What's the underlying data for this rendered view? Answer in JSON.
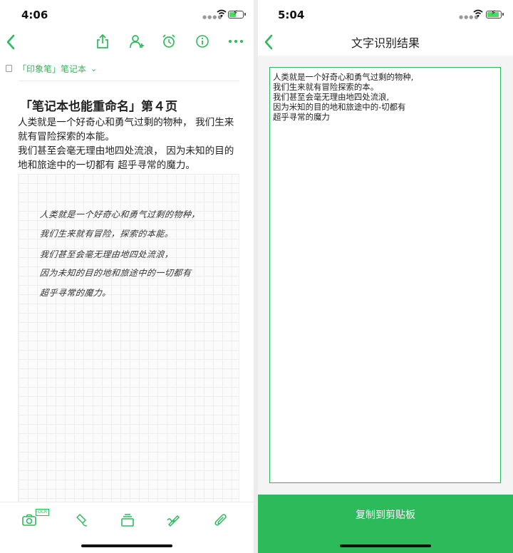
{
  "left": {
    "status": {
      "time": "4:06"
    },
    "notebook": {
      "label": "「印象笔」笔记本"
    },
    "note": {
      "title": "「笔记本也能重命名」第４页",
      "body": [
        "人类就是一个好奇心和勇气过剩的物种， 我们生来",
        "就有冒险探索的本能。",
        "我们甚至会毫无理由地四处流浪， 因为未知的目的",
        "地和旅途中的一切都有 超乎寻常的魔力。"
      ],
      "handwriting": [
        "人类就是一个好奇心和勇气过剩的物种，",
        "我们生来就有冒险，探索的本能。",
        "我们甚至会毫无理由地四处流浪，",
        "因为未知的目的地和旅途中的一切都有",
        "超乎寻常的魔力。"
      ]
    },
    "toolbar": {
      "ocr_badge": "OCR"
    }
  },
  "right": {
    "status": {
      "time": "5:04"
    },
    "title": "文字识别结果",
    "result_lines": [
      "人类就是一个好奇心和勇气过剩的物种,",
      "我们生来就有冒险探索的本。",
      "我们甚至会毫无理由地四处流浪,",
      "因为米知的目的地和旅途中的-切都有",
      "超乎寻常的魔力"
    ],
    "copy_button": "复制到剪贴板"
  },
  "icons": {
    "back": "chevron-left-icon",
    "share": "share-icon",
    "add_user": "add-user-icon",
    "alarm": "alarm-icon",
    "info": "info-icon",
    "more": "more-icon",
    "camera_ocr": "camera-ocr-icon",
    "handwriting": "pen-icon",
    "stack": "stack-icon",
    "sketch": "sketch-icon",
    "attachment": "paperclip-icon"
  },
  "colors": {
    "accent": "#2dba5a",
    "battery": "#4cd964"
  }
}
